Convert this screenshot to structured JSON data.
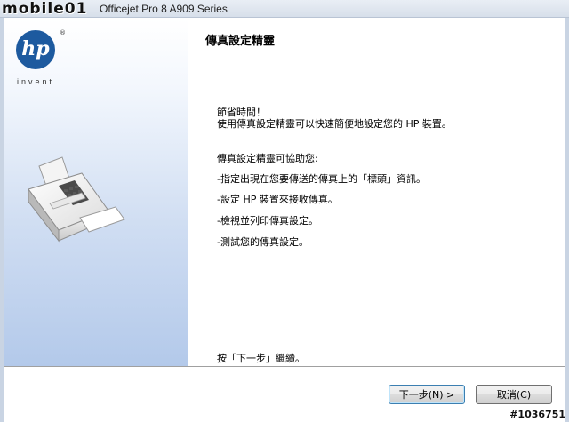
{
  "window": {
    "title": "Officejet Pro 8 A909 Series",
    "watermark_top": "mobile01",
    "watermark_bottom": "#1036751"
  },
  "sidebar": {
    "logo_text": "hp",
    "logo_registered": "®",
    "logo_tagline": "invent",
    "illustration_icon": "fax-machine-icon"
  },
  "main": {
    "title": "傳真設定精靈",
    "greeting": "節省時間！",
    "intro": "使用傳真設定精靈可以快速簡便地設定您的 HP 裝置。",
    "help_heading": "傳真設定精靈可協助您:",
    "bullets": [
      "-指定出現在您要傳送的傳真上的「標頭」資訊。",
      "-設定 HP 裝置來接收傳真。",
      "-檢視並列印傳真設定。",
      "-測試您的傳真設定。"
    ],
    "continue_hint": "按「下一步」繼續。"
  },
  "buttons": {
    "next_label": "下一步(N) >",
    "cancel_label": "取消(C)"
  },
  "colors": {
    "hp_blue": "#1d5a9f",
    "sidebar_gradient_end": "#b3c9ea",
    "default_button_border": "#3c7fb1"
  }
}
